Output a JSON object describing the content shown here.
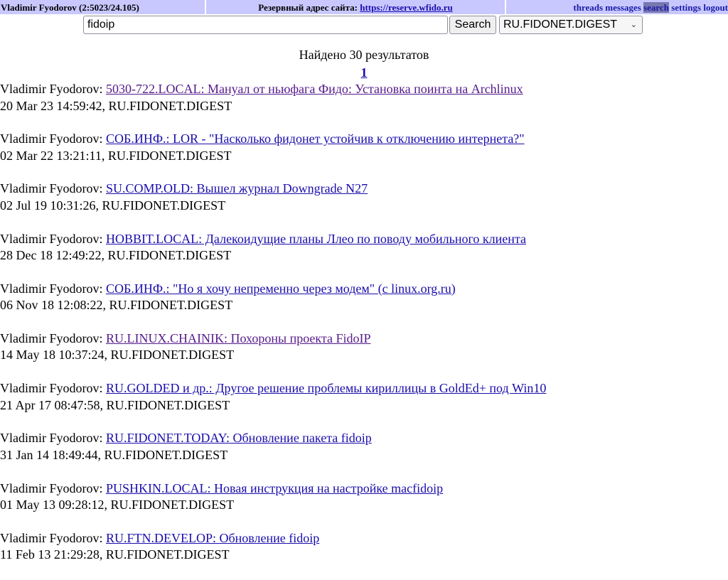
{
  "header": {
    "user": "Vladimir Fyodorov (2:5023/24.105)",
    "reserve_label": "Резервный адрес сайта:",
    "reserve_link": "https://reserve.wfido.ru",
    "nav": [
      {
        "label": "threads",
        "active": false
      },
      {
        "label": "messages",
        "active": false
      },
      {
        "label": "search",
        "active": true
      },
      {
        "label": "settings",
        "active": false
      },
      {
        "label": "logout",
        "active": false
      }
    ]
  },
  "search": {
    "value": "fidoip",
    "button_label": "Search",
    "area_selected": "RU.FIDONET.DIGEST"
  },
  "summary": "Найдено 30 результатов",
  "pager": {
    "current": "1"
  },
  "results": [
    {
      "author": "Vladimir Fyodorov:",
      "title": "5030-722.LOCAL: Мануал от ньюфага Фидо: Установка поинта на Archlinux",
      "meta": "20 Mar 23 14:59:42, RU.FIDONET.DIGEST",
      "visited": true
    },
    {
      "author": "Vladimir Fyodorov:",
      "title": "СОБ.ИНФ.: LOR - \"Насколько фидонет устойчив к отключению интернета?\"",
      "meta": "02 Mar 22 13:21:11, RU.FIDONET.DIGEST",
      "visited": false
    },
    {
      "author": "Vladimir Fyodorov:",
      "title": "SU.COMP.OLD: Вышел журнал Downgrade N27",
      "meta": "02 Jul 19 10:31:26, RU.FIDONET.DIGEST",
      "visited": false
    },
    {
      "author": "Vladimir Fyodorov:",
      "title": "HOBBIT.LOCAL: Далекоидущие планы Ллео по поводу мобильного клиента",
      "meta": "28 Dec 18 12:49:22, RU.FIDONET.DIGEST",
      "visited": false
    },
    {
      "author": "Vladimir Fyodorov:",
      "title": "СОБ.ИНФ.: \"Но я хочу непременно через модем\" (с linux.org.ru)",
      "meta": "06 Nov 18 12:08:22, RU.FIDONET.DIGEST",
      "visited": false
    },
    {
      "author": "Vladimir Fyodorov:",
      "title": "RU.LINUX.CHAINIK: Похороны проекта FidoIP",
      "meta": "14 May 18 10:37:24, RU.FIDONET.DIGEST",
      "visited": true
    },
    {
      "author": "Vladimir Fyodorov:",
      "title": "RU.GOLDED и др.: Другое решение проблемы кириллицы в GoldEd+ под Win10",
      "meta": "21 Apr 17 08:47:58, RU.FIDONET.DIGEST",
      "visited": false
    },
    {
      "author": "Vladimir Fyodorov:",
      "title": "RU.FIDONET.TODAY: Обновление пакета fidoip",
      "meta": "31 Jan 14 18:49:44, RU.FIDONET.DIGEST",
      "visited": false
    },
    {
      "author": "Vladimir Fyodorov:",
      "title": "PUSHKIN.LOCAL: Новая инструкция на настройке macfidoip",
      "meta": "01 May 13 09:28:12, RU.FIDONET.DIGEST",
      "visited": false
    },
    {
      "author": "Vladimir Fyodorov:",
      "title": "RU.FTN.DEVELOP: Обновление fidoip",
      "meta": "11 Feb 13 21:29:28, RU.FIDONET.DIGEST",
      "visited": false
    }
  ],
  "colors": {
    "header_bg": "#c8c8ff",
    "link": "#1a0dab",
    "visited_link": "#551a8b",
    "nav_link": "#1a1aa6",
    "nav_active_bg": "#7878b0"
  }
}
